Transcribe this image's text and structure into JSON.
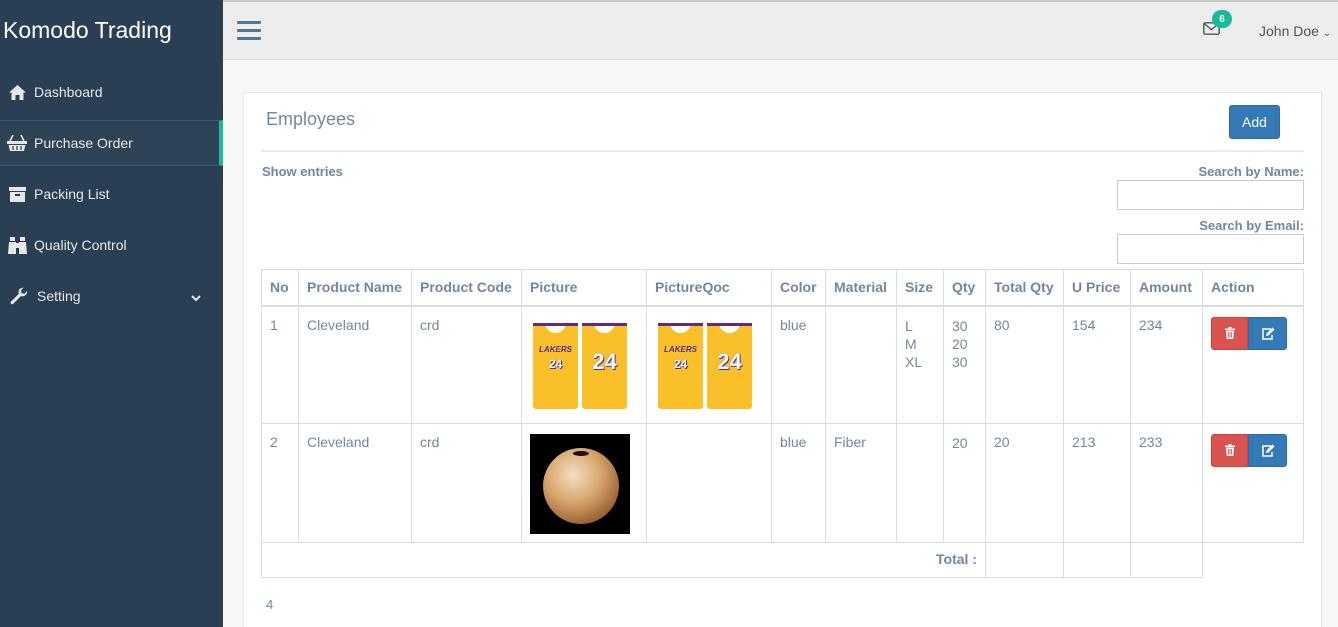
{
  "brand": "Komodo Trading",
  "sidebar": {
    "items": [
      {
        "label": "Dashboard",
        "icon": "home-icon"
      },
      {
        "label": "Purchase Order",
        "icon": "basket-icon",
        "active": true
      },
      {
        "label": "Packing List",
        "icon": "archive-icon"
      },
      {
        "label": "Quality Control",
        "icon": "binoculars-icon"
      },
      {
        "label": "Setting",
        "icon": "wrench-icon",
        "has_submenu": true
      }
    ]
  },
  "topnav": {
    "mail_count": "6",
    "user_name": "John Doe"
  },
  "panel": {
    "title": "Employees",
    "add_label": "Add",
    "show_entries": "Show entries",
    "search_name_label": "Search by Name:",
    "search_email_label": "Search by Email:",
    "search_name_value": "",
    "search_email_value": ""
  },
  "table": {
    "headers": [
      "No",
      "Product Name",
      "Product Code",
      "Picture",
      "PictureQoc",
      "Color",
      "Material",
      "Size",
      "Qty",
      "Total Qty",
      "U Price",
      "Amount",
      "Action"
    ],
    "rows": [
      {
        "no": "1",
        "product_name": "Cleveland",
        "product_code": "crd",
        "picture": "jersey-image",
        "picture_qoc": "jersey-image",
        "color": "blue",
        "material": "",
        "sizes": [
          "L",
          "M",
          "XL"
        ],
        "qtys": [
          "30",
          "20",
          "30"
        ],
        "total_qty": "80",
        "u_price": "154",
        "amount": "234"
      },
      {
        "no": "2",
        "product_name": "Cleveland",
        "product_code": "crd",
        "picture": "vase-image",
        "picture_qoc": "",
        "color": "blue",
        "material": "Fiber",
        "sizes": [],
        "qtys": [
          "20"
        ],
        "total_qty": "20",
        "u_price": "213",
        "amount": "233"
      }
    ],
    "jersey_text": "LAKERS",
    "jersey_num_front": "24",
    "jersey_num_back": "24",
    "total_label": "Total :"
  },
  "pager": "4",
  "colors": {
    "sidebar": "#2A3F54",
    "accent": "#1ABB9C",
    "primary": "#337AB7",
    "danger": "#D9534F"
  }
}
